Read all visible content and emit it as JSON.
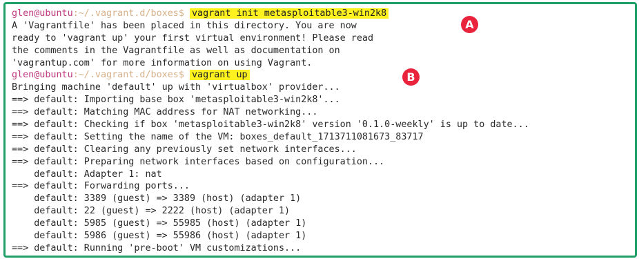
{
  "colors": {
    "frame_border": "#1fa068",
    "prompt_user": "#c0397f",
    "prompt_path": "#d7b18a",
    "command_highlight": "#fdf11f",
    "badge": "#e8233b"
  },
  "terminal": {
    "prompt_1": {
      "user": "glen@ubuntu",
      "path": ":~/.vagrant.d/boxes$",
      "command": "vagrant init metasploitable3-win2k8"
    },
    "init_output": [
      "A 'Vagrantfile' has been placed in this directory. You are now",
      "ready to 'vagrant up' your first virtual environment! Please read",
      "the comments in the Vagrantfile as well as documentation on",
      "'vagrantup.com' for more information on using Vagrant."
    ],
    "prompt_2": {
      "user": "glen@ubuntu",
      "path": ":~/.vagrant.d/boxes$",
      "command": "vagrant up"
    },
    "up_output": [
      "Bringing machine 'default' up with 'virtualbox' provider...",
      "==> default: Importing base box 'metasploitable3-win2k8'...",
      "==> default: Matching MAC address for NAT networking...",
      "==> default: Checking if box 'metasploitable3-win2k8' version '0.1.0-weekly' is up to date...",
      "==> default: Setting the name of the VM: boxes_default_1713711081673_83717",
      "==> default: Clearing any previously set network interfaces...",
      "==> default: Preparing network interfaces based on configuration...",
      "    default: Adapter 1: nat",
      "==> default: Forwarding ports...",
      "    default: 3389 (guest) => 3389 (host) (adapter 1)",
      "    default: 22 (guest) => 2222 (host) (adapter 1)",
      "    default: 5985 (guest) => 55985 (host) (adapter 1)",
      "    default: 5986 (guest) => 55986 (host) (adapter 1)",
      "==> default: Running 'pre-boot' VM customizations..."
    ]
  },
  "annotations": {
    "a": "A",
    "b": "B"
  }
}
